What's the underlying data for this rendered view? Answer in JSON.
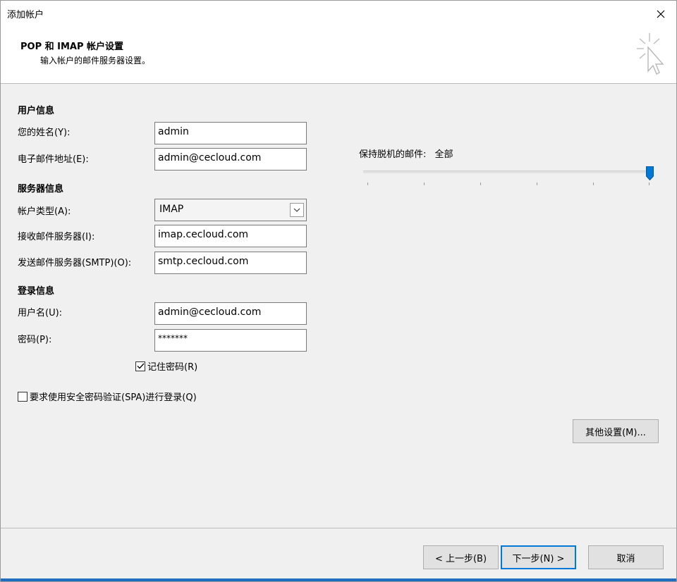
{
  "window": {
    "title": "添加帐户"
  },
  "header": {
    "title": "POP 和 IMAP 帐户设置",
    "subtitle": "输入帐户的邮件服务器设置。"
  },
  "user_info": {
    "section": "用户信息",
    "name_label": "您的姓名(Y):",
    "name_value": "admin",
    "email_label": "电子邮件地址(E):",
    "email_value": "admin@cecloud.com"
  },
  "server_info": {
    "section": "服务器信息",
    "account_type_label": "帐户类型(A):",
    "account_type_value": "IMAP",
    "incoming_label": "接收邮件服务器(I):",
    "incoming_value": "imap.cecloud.com",
    "outgoing_label": "发送邮件服务器(SMTP)(O):",
    "outgoing_value": "smtp.cecloud.com"
  },
  "login_info": {
    "section": "登录信息",
    "username_label": "用户名(U):",
    "username_value": "admin@cecloud.com",
    "password_label": "密码(P):",
    "password_value": "*******",
    "remember_label": "记住密码(R)",
    "remember_checked": true,
    "spa_label": "要求使用安全密码验证(SPA)进行登录(Q)",
    "spa_checked": false
  },
  "offline": {
    "label": "保持脱机的邮件:",
    "value": "全部",
    "level": 1.0
  },
  "buttons": {
    "more_settings": "其他设置(M)...",
    "back": "< 上一步(B)",
    "next": "下一步(N) >",
    "cancel": "取消"
  },
  "colors": {
    "accent": "#0078d7"
  }
}
